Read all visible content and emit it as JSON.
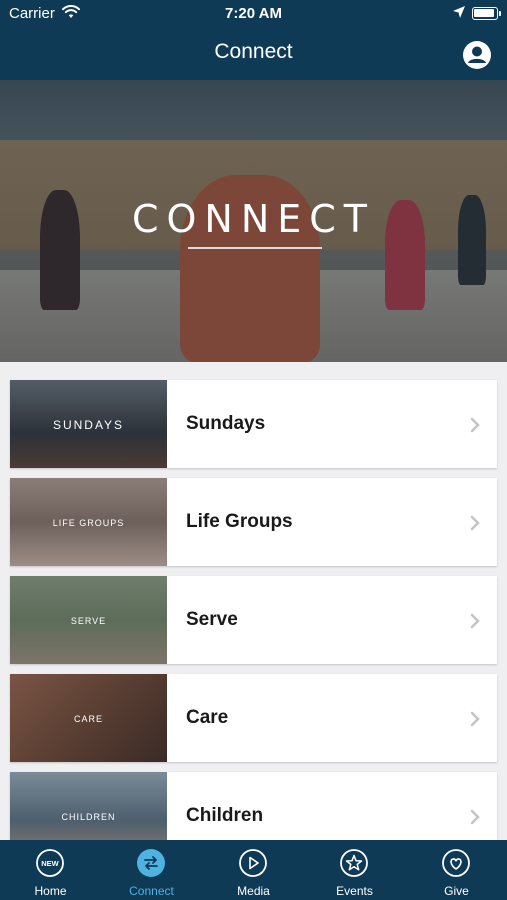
{
  "status_bar": {
    "carrier": "Carrier",
    "time": "7:20 AM"
  },
  "nav": {
    "title": "Connect",
    "profile_icon": "person-circle-icon"
  },
  "hero": {
    "title": "CONNECT"
  },
  "items": [
    {
      "label": "Sundays",
      "thumb_label": "SUNDAYS",
      "thumb_color": "#3a4149"
    },
    {
      "label": "Life Groups",
      "thumb_label": "LIFE GROUPS",
      "thumb_color": "#6d5f5a"
    },
    {
      "label": "Serve",
      "thumb_label": "SERVE",
      "thumb_color": "#5e6c5a"
    },
    {
      "label": "Care",
      "thumb_label": "CARE",
      "thumb_color": "#5a3f33"
    },
    {
      "label": "Children",
      "thumb_label": "CHILDREN",
      "thumb_color": "#4d5f6e"
    }
  ],
  "tabs": [
    {
      "label": "Home",
      "icon": "new-badge-icon",
      "icon_text": "NEW",
      "active": false
    },
    {
      "label": "Connect",
      "icon": "swap-arrows-icon",
      "active": true
    },
    {
      "label": "Media",
      "icon": "play-icon",
      "active": false
    },
    {
      "label": "Events",
      "icon": "star-icon",
      "active": false
    },
    {
      "label": "Give",
      "icon": "heart-icon",
      "active": false
    }
  ],
  "colors": {
    "header": "#0f3a55",
    "active_tab": "#4fb3e2",
    "background": "#efeff1"
  }
}
